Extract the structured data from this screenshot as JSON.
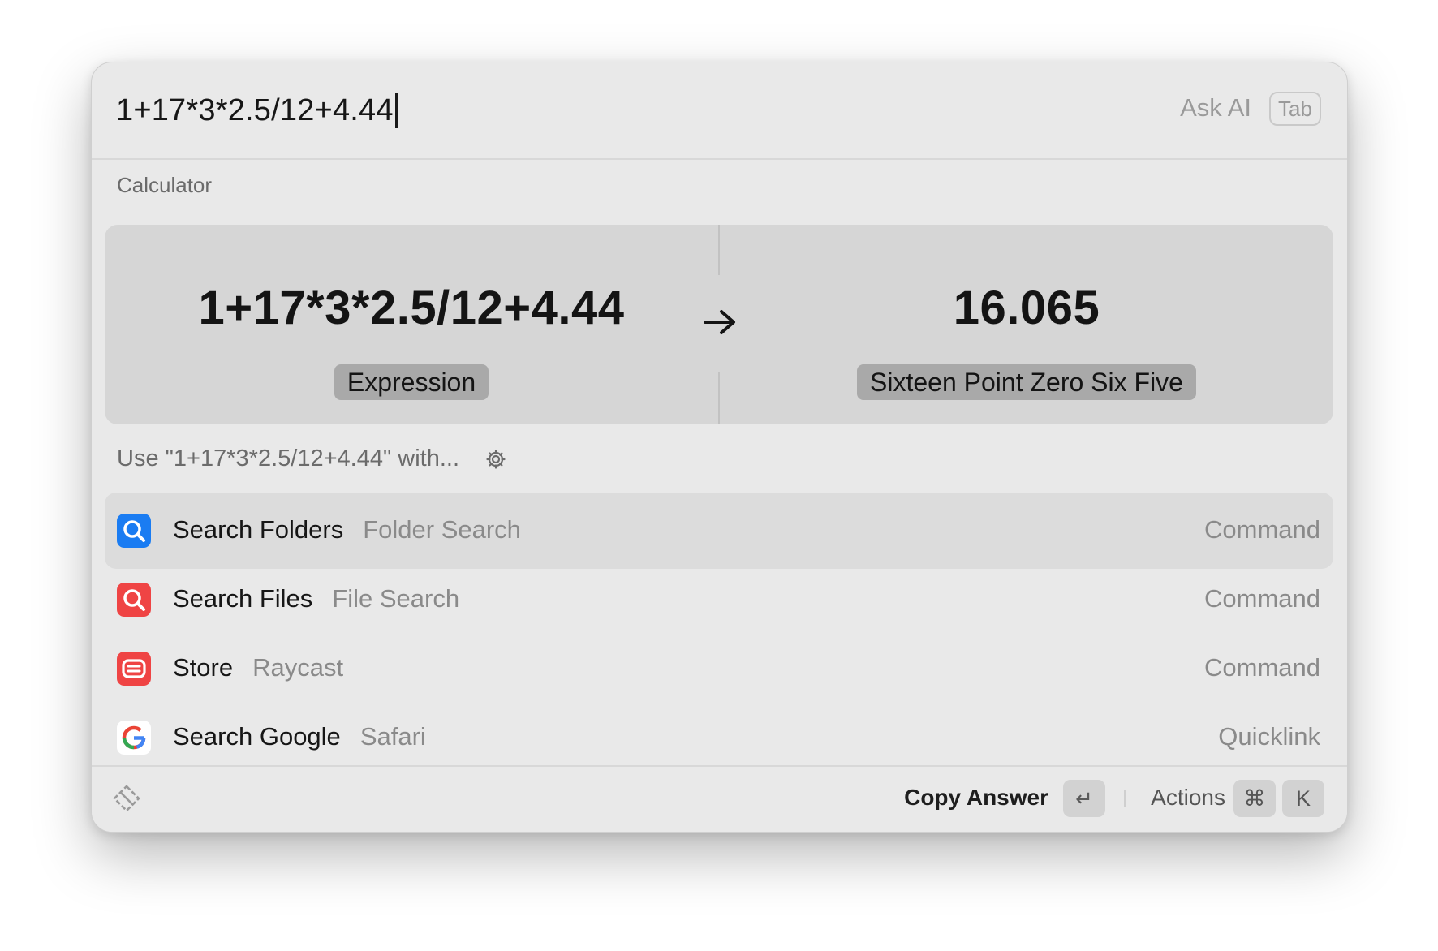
{
  "search": {
    "query": "1+17*3*2.5/12+4.44",
    "ask_ai_label": "Ask AI",
    "tab_key": "Tab"
  },
  "calculator": {
    "section_label": "Calculator",
    "expression": "1+17*3*2.5/12+4.44",
    "expression_label": "Expression",
    "result": "16.065",
    "result_words": "Sixteen Point Zero Six Five"
  },
  "use_with": {
    "label": "Use \"1+17*3*2.5/12+4.44\" with..."
  },
  "list": {
    "items": [
      {
        "title": "Search Folders",
        "subtitle": "Folder Search",
        "kind": "Command",
        "icon": "folder-search-icon",
        "color": "#1a7cf2",
        "selected": true
      },
      {
        "title": "Search Files",
        "subtitle": "File Search",
        "kind": "Command",
        "icon": "file-search-icon",
        "color": "#ef4444",
        "selected": false
      },
      {
        "title": "Store",
        "subtitle": "Raycast",
        "kind": "Command",
        "icon": "store-icon",
        "color": "#ef4444",
        "selected": false
      },
      {
        "title": "Search Google",
        "subtitle": "Safari",
        "kind": "Quicklink",
        "icon": "google-icon",
        "color": "#4285f4",
        "selected": false
      }
    ]
  },
  "footer": {
    "primary_action": "Copy Answer",
    "enter_key": "↵",
    "actions_label": "Actions",
    "cmd_key": "⌘",
    "k_key": "K"
  }
}
